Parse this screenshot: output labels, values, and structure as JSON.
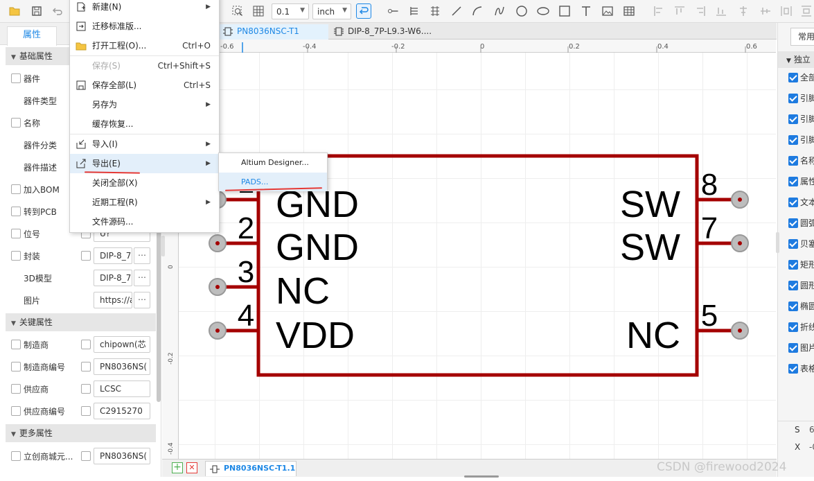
{
  "toolbar": {
    "grid_size": "0.1",
    "unit": "inch"
  },
  "left_panel": {
    "tab_label": "属性",
    "section_basic": "基础属性",
    "basic_rows": [
      {
        "label": "器件",
        "has_checkbox": true
      },
      {
        "label": "器件类型",
        "has_checkbox": false
      },
      {
        "label": "名称",
        "has_checkbox": true
      },
      {
        "label": "器件分类",
        "has_checkbox": false
      },
      {
        "label": "器件描述",
        "has_checkbox": false
      },
      {
        "label": "加入BOM",
        "has_checkbox": true
      },
      {
        "label": "转到PCB",
        "has_checkbox": true
      }
    ],
    "designator": {
      "label": "位号",
      "value": "U?"
    },
    "footprint": {
      "label": "封装",
      "value": "DIP-8_7I"
    },
    "model3d": {
      "label": "3D模型",
      "value": "DIP-8_7I"
    },
    "image": {
      "label": "图片",
      "value": "https://a"
    },
    "section_key": "关键属性",
    "manufacturer": {
      "label": "制造商",
      "value": "chipown(芯"
    },
    "mfr_part": {
      "label": "制造商编号",
      "value": "PN8036NS("
    },
    "supplier": {
      "label": "供应商",
      "value": "LCSC"
    },
    "supplier_part": {
      "label": "供应商编号",
      "value": "C2915270"
    },
    "section_more": "更多属性",
    "lcsc_part": {
      "label": "立创商城元...",
      "value": "PN8036NS("
    }
  },
  "file_menu": {
    "items": [
      {
        "label": "新建(N)",
        "shortcut": "",
        "submenu": true,
        "icon": "new-file-icon",
        "disabled": false
      },
      {
        "label": "迁移标准版...",
        "shortcut": "",
        "submenu": false,
        "icon": "migrate-icon",
        "disabled": false
      },
      {
        "label": "打开工程(O)...",
        "shortcut": "Ctrl+O",
        "submenu": false,
        "icon": "folder-icon",
        "disabled": false
      },
      {
        "label": "保存(S)",
        "shortcut": "Ctrl+Shift+S",
        "submenu": false,
        "icon": "",
        "disabled": true
      },
      {
        "label": "保存全部(L)",
        "shortcut": "Ctrl+S",
        "submenu": false,
        "icon": "save-all-icon",
        "disabled": false
      },
      {
        "label": "另存为",
        "shortcut": "",
        "submenu": true,
        "icon": "",
        "disabled": false
      },
      {
        "label": "缓存恢复...",
        "shortcut": "",
        "submenu": false,
        "icon": "",
        "disabled": false
      },
      {
        "label": "导入(I)",
        "shortcut": "",
        "submenu": true,
        "icon": "import-icon",
        "disabled": false
      },
      {
        "label": "导出(E)",
        "shortcut": "",
        "submenu": true,
        "icon": "export-icon",
        "disabled": false
      },
      {
        "label": "关闭全部(X)",
        "shortcut": "",
        "submenu": false,
        "icon": "",
        "disabled": false
      },
      {
        "label": "近期工程(R)",
        "shortcut": "",
        "submenu": true,
        "icon": "",
        "disabled": false
      },
      {
        "label": "文件源码...",
        "shortcut": "",
        "submenu": false,
        "icon": "",
        "disabled": false
      }
    ]
  },
  "export_submenu": {
    "items": [
      "Altium Designer...",
      "PADS..."
    ]
  },
  "doc_tabs": [
    {
      "label": "PN8036NSC-T1",
      "active": true
    },
    {
      "label": "DIP-8_7P-L9.3-W6....",
      "active": false
    }
  ],
  "ruler_top": [
    "-0.6",
    "-0.4",
    "-0.2",
    "0",
    "0.2",
    "0.4",
    "0.6"
  ],
  "ruler_left": [
    "0",
    "-0.2",
    "-0.4"
  ],
  "symbol": {
    "left_pins": [
      {
        "number": "1",
        "name": "GND"
      },
      {
        "number": "2",
        "name": "GND"
      },
      {
        "number": "3",
        "name": "NC"
      },
      {
        "number": "4",
        "name": "VDD"
      }
    ],
    "right_pins": [
      {
        "number": "8",
        "name": "SW"
      },
      {
        "number": "7",
        "name": "SW"
      },
      {
        "number": "5",
        "name": "NC"
      }
    ],
    "body_color": "#a40000",
    "pin_end_color": "#999999"
  },
  "bottom": {
    "sheet_tab": "PN8036NSC-T1.1"
  },
  "right_panel": {
    "tab": "常用",
    "section": "独立",
    "items": [
      "全部",
      "引脚",
      "引脚",
      "引脚",
      "名称",
      "属性",
      "文本",
      "圆弧",
      "贝塞",
      "矩形",
      "圆形",
      "椭圆",
      "折线",
      "图片",
      "表格"
    ],
    "coords": [
      {
        "label": "S",
        "value": "6"
      },
      {
        "label": "X",
        "value": "-0"
      }
    ]
  },
  "watermark": "CSDN @firewood2024",
  "accent_color": "#1e88e5"
}
